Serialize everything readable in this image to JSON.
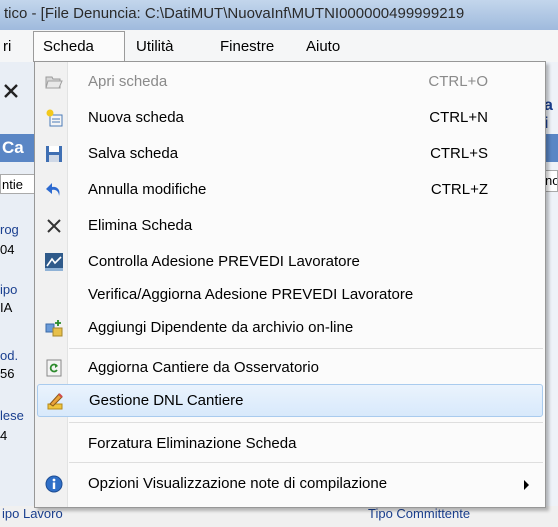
{
  "window": {
    "title": "tico - [File Denuncia: C:\\DatiMUT\\NuovaInf\\MUTNI000000499999219"
  },
  "menubar": {
    "items": [
      "ri",
      "Scheda",
      "Utilità",
      "Finestre",
      "Aiuto"
    ],
    "active": "Scheda"
  },
  "background": {
    "left_strip": [
      "rog",
      "04",
      "ipo",
      "IA",
      "od.",
      "56",
      "lese",
      "4",
      "ipo Lavoro"
    ],
    "header_left": "Ca",
    "header_right": "a i",
    "left_field": "ntie",
    "right_field": "nor",
    "bottom_right": "Tipo Committente"
  },
  "menu": {
    "items": [
      {
        "label": "Apri scheda",
        "shortcut": "CTRL+O",
        "icon": "open-folder-icon",
        "disabled": true
      },
      {
        "label": "Nuova scheda",
        "shortcut": "CTRL+N",
        "icon": "new-document-icon"
      },
      {
        "label": "Salva scheda",
        "shortcut": "CTRL+S",
        "icon": "save-disk-icon"
      },
      {
        "label": "Annulla modifiche",
        "shortcut": "CTRL+Z",
        "icon": "undo-icon"
      },
      {
        "label": "Elimina Scheda",
        "shortcut": "",
        "icon": "delete-x-icon"
      },
      {
        "label": "Controlla Adesione PREVEDI Lavoratore",
        "shortcut": "",
        "icon": "chart-icon"
      },
      {
        "label": "Verifica/Aggiorna Adesione PREVEDI Lavoratore",
        "shortcut": "",
        "icon": ""
      },
      {
        "label": "Aggiungi Dipendente da archivio on-line",
        "shortcut": "",
        "icon": "add-employee-icon"
      },
      {
        "label": "Aggiorna Cantiere da Osservatorio",
        "shortcut": "",
        "icon": "refresh-icon"
      },
      {
        "label": "Gestione DNL Cantiere",
        "shortcut": "",
        "icon": "pencil-edit-icon",
        "highlighted": true
      },
      {
        "label": "Forzatura Eliminazione Scheda",
        "shortcut": "",
        "icon": ""
      },
      {
        "label": "Opzioni Visualizzazione note di compilazione",
        "shortcut": "",
        "icon": "info-icon",
        "submenu": true
      }
    ]
  }
}
